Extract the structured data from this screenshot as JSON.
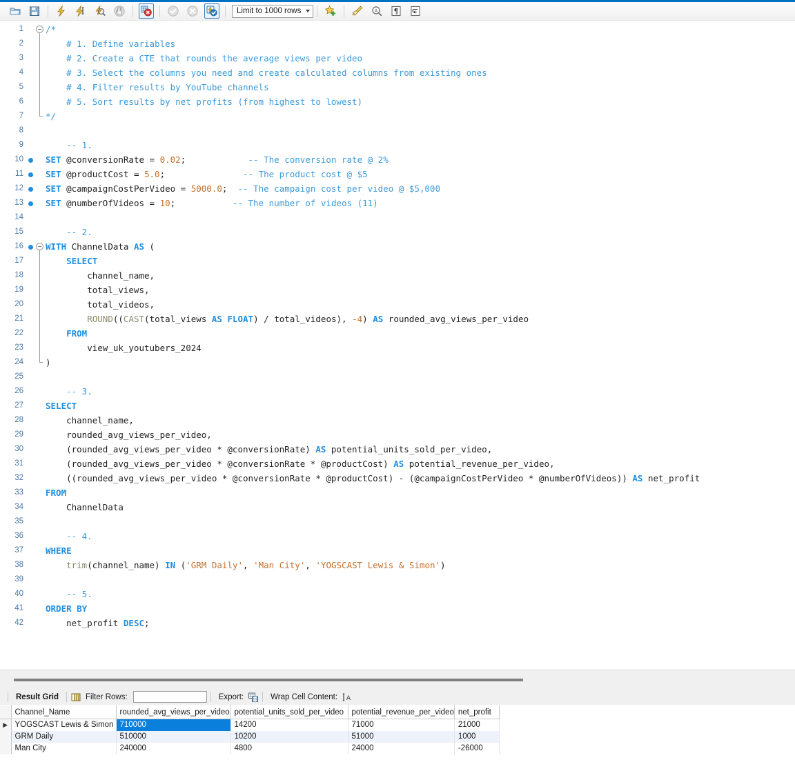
{
  "toolbar": {
    "items": [
      {
        "name": "open-sql-script-icon",
        "kind": "folder",
        "framed": false
      },
      {
        "name": "save-script-icon",
        "kind": "save",
        "framed": false
      },
      {
        "name": "separator",
        "kind": "sep"
      },
      {
        "name": "execute-statement-icon",
        "kind": "bolt",
        "framed": false
      },
      {
        "name": "execute-current-statement-icon",
        "kind": "bolt-cursor",
        "framed": false
      },
      {
        "name": "explain-statement-icon",
        "kind": "bolt-magnifier",
        "framed": false
      },
      {
        "name": "stop-execution-icon",
        "kind": "stop-hand",
        "framed": false
      },
      {
        "name": "separator",
        "kind": "sep"
      },
      {
        "name": "toggle-stop-on-error-icon",
        "kind": "stop-on-error",
        "framed": true
      },
      {
        "name": "separator",
        "kind": "sep"
      },
      {
        "name": "commit-transaction-icon",
        "kind": "commit",
        "framed": false
      },
      {
        "name": "rollback-transaction-icon",
        "kind": "rollback",
        "framed": false
      },
      {
        "name": "toggle-autocommit-icon",
        "kind": "autocommit",
        "framed": true
      },
      {
        "name": "separator",
        "kind": "sep"
      }
    ],
    "limit_combo": {
      "label": "Limit to 1000 rows",
      "name": "row-limit-dropdown"
    },
    "items_right": [
      {
        "name": "separator",
        "kind": "sep"
      },
      {
        "name": "save-snippet-icon",
        "kind": "star-plus",
        "framed": false
      },
      {
        "name": "separator",
        "kind": "sep"
      },
      {
        "name": "beautify-query-icon",
        "kind": "broom",
        "framed": false
      },
      {
        "name": "find-icon",
        "kind": "magnifier",
        "framed": false
      },
      {
        "name": "toggle-invisible-chars-icon",
        "kind": "pilcrow",
        "framed": false
      },
      {
        "name": "toggle-wrapping-icon",
        "kind": "wrap-arrow",
        "framed": false
      }
    ]
  },
  "editor": {
    "lines": [
      {
        "n": 1,
        "bp": false,
        "fold": "open",
        "tokens": [
          {
            "t": "/*",
            "c": "cmt"
          }
        ]
      },
      {
        "n": 2,
        "bp": false,
        "fold": "bar",
        "tokens": [
          {
            "t": "    # 1. Define variables",
            "c": "cmt"
          }
        ]
      },
      {
        "n": 3,
        "bp": false,
        "fold": "bar",
        "tokens": [
          {
            "t": "    # 2. Create a CTE that rounds the average views per video",
            "c": "cmt"
          }
        ]
      },
      {
        "n": 4,
        "bp": false,
        "fold": "bar",
        "tokens": [
          {
            "t": "    # 3. Select the columns you need and create calculated columns from existing ones",
            "c": "cmt"
          }
        ]
      },
      {
        "n": 5,
        "bp": false,
        "fold": "bar",
        "tokens": [
          {
            "t": "    # 4. Filter results by YouTube channels",
            "c": "cmt"
          }
        ]
      },
      {
        "n": 6,
        "bp": false,
        "fold": "bar",
        "tokens": [
          {
            "t": "    # 5. Sort results by net profits (from highest to lowest)",
            "c": "cmt"
          }
        ]
      },
      {
        "n": 7,
        "bp": false,
        "fold": "end",
        "tokens": [
          {
            "t": "*/",
            "c": "cmt"
          }
        ]
      },
      {
        "n": 8,
        "bp": false,
        "fold": "",
        "tokens": []
      },
      {
        "n": 9,
        "bp": false,
        "fold": "",
        "tokens": [
          {
            "t": "    -- 1.",
            "c": "cmt"
          }
        ]
      },
      {
        "n": 10,
        "bp": true,
        "fold": "",
        "tokens": [
          {
            "t": "SET ",
            "c": "kw"
          },
          {
            "t": "@conversionRate = ",
            "c": "pln"
          },
          {
            "t": "0.02",
            "c": "numl"
          },
          {
            "t": ";            ",
            "c": "pln"
          },
          {
            "t": "-- The conversion rate @ 2%",
            "c": "cmt"
          }
        ]
      },
      {
        "n": 11,
        "bp": true,
        "fold": "",
        "tokens": [
          {
            "t": "SET ",
            "c": "kw"
          },
          {
            "t": "@productCost = ",
            "c": "pln"
          },
          {
            "t": "5.0",
            "c": "numl"
          },
          {
            "t": ";               ",
            "c": "pln"
          },
          {
            "t": "-- The product cost @ $5",
            "c": "cmt"
          }
        ]
      },
      {
        "n": 12,
        "bp": true,
        "fold": "",
        "tokens": [
          {
            "t": "SET ",
            "c": "kw"
          },
          {
            "t": "@campaignCostPerVideo = ",
            "c": "pln"
          },
          {
            "t": "5000.0",
            "c": "numl"
          },
          {
            "t": ";  ",
            "c": "pln"
          },
          {
            "t": "-- The campaign cost per video @ $5,000",
            "c": "cmt"
          }
        ]
      },
      {
        "n": 13,
        "bp": true,
        "fold": "",
        "tokens": [
          {
            "t": "SET ",
            "c": "kw"
          },
          {
            "t": "@numberOfVideos = ",
            "c": "pln"
          },
          {
            "t": "10",
            "c": "numl"
          },
          {
            "t": ";           ",
            "c": "pln"
          },
          {
            "t": "-- The number of videos (11)",
            "c": "cmt"
          }
        ]
      },
      {
        "n": 14,
        "bp": false,
        "fold": "",
        "tokens": []
      },
      {
        "n": 15,
        "bp": false,
        "fold": "",
        "tokens": [
          {
            "t": "    -- 2.",
            "c": "cmt"
          }
        ]
      },
      {
        "n": 16,
        "bp": true,
        "fold": "open",
        "tokens": [
          {
            "t": "WITH ",
            "c": "kw"
          },
          {
            "t": "ChannelData ",
            "c": "pln"
          },
          {
            "t": "AS",
            "c": "kw"
          },
          {
            "t": " (",
            "c": "pln"
          }
        ]
      },
      {
        "n": 17,
        "bp": false,
        "fold": "bar",
        "tokens": [
          {
            "t": "    SELECT",
            "c": "kw"
          }
        ]
      },
      {
        "n": 18,
        "bp": false,
        "fold": "bar",
        "tokens": [
          {
            "t": "        channel_name,",
            "c": "pln"
          }
        ]
      },
      {
        "n": 19,
        "bp": false,
        "fold": "bar",
        "tokens": [
          {
            "t": "        total_views,",
            "c": "pln"
          }
        ]
      },
      {
        "n": 20,
        "bp": false,
        "fold": "bar",
        "tokens": [
          {
            "t": "        total_videos,",
            "c": "pln"
          }
        ]
      },
      {
        "n": 21,
        "bp": false,
        "fold": "bar",
        "tokens": [
          {
            "t": "        ",
            "c": "pln"
          },
          {
            "t": "ROUND",
            "c": "fn"
          },
          {
            "t": "((",
            "c": "pln"
          },
          {
            "t": "CAST",
            "c": "fn"
          },
          {
            "t": "(total_views ",
            "c": "pln"
          },
          {
            "t": "AS FLOAT",
            "c": "kw"
          },
          {
            "t": ") / total_videos), ",
            "c": "pln"
          },
          {
            "t": "-4",
            "c": "numl"
          },
          {
            "t": ") ",
            "c": "pln"
          },
          {
            "t": "AS",
            "c": "kw"
          },
          {
            "t": " rounded_avg_views_per_video",
            "c": "pln"
          }
        ]
      },
      {
        "n": 22,
        "bp": false,
        "fold": "bar",
        "tokens": [
          {
            "t": "    FROM",
            "c": "kw"
          }
        ]
      },
      {
        "n": 23,
        "bp": false,
        "fold": "bar",
        "tokens": [
          {
            "t": "        view_uk_youtubers_2024",
            "c": "pln"
          }
        ]
      },
      {
        "n": 24,
        "bp": false,
        "fold": "end",
        "tokens": [
          {
            "t": ")",
            "c": "pln"
          }
        ]
      },
      {
        "n": 25,
        "bp": false,
        "fold": "",
        "tokens": []
      },
      {
        "n": 26,
        "bp": false,
        "fold": "",
        "tokens": [
          {
            "t": "    -- 3.",
            "c": "cmt"
          }
        ]
      },
      {
        "n": 27,
        "bp": false,
        "fold": "",
        "tokens": [
          {
            "t": "SELECT",
            "c": "kw"
          }
        ]
      },
      {
        "n": 28,
        "bp": false,
        "fold": "",
        "tokens": [
          {
            "t": "    channel_name,",
            "c": "pln"
          }
        ]
      },
      {
        "n": 29,
        "bp": false,
        "fold": "",
        "tokens": [
          {
            "t": "    rounded_avg_views_per_video,",
            "c": "pln"
          }
        ]
      },
      {
        "n": 30,
        "bp": false,
        "fold": "",
        "tokens": [
          {
            "t": "    (rounded_avg_views_per_video * @conversionRate) ",
            "c": "pln"
          },
          {
            "t": "AS",
            "c": "kw"
          },
          {
            "t": " potential_units_sold_per_video,",
            "c": "pln"
          }
        ]
      },
      {
        "n": 31,
        "bp": false,
        "fold": "",
        "tokens": [
          {
            "t": "    (rounded_avg_views_per_video * @conversionRate * @productCost) ",
            "c": "pln"
          },
          {
            "t": "AS",
            "c": "kw"
          },
          {
            "t": " potential_revenue_per_video,",
            "c": "pln"
          }
        ]
      },
      {
        "n": 32,
        "bp": false,
        "fold": "",
        "tokens": [
          {
            "t": "    ((rounded_avg_views_per_video * @conversionRate * @productCost) - (@campaignCostPerVideo * @numberOfVideos)) ",
            "c": "pln"
          },
          {
            "t": "AS",
            "c": "kw"
          },
          {
            "t": " net_profit",
            "c": "pln"
          }
        ]
      },
      {
        "n": 33,
        "bp": false,
        "fold": "",
        "tokens": [
          {
            "t": "FROM",
            "c": "kw"
          }
        ]
      },
      {
        "n": 34,
        "bp": false,
        "fold": "",
        "tokens": [
          {
            "t": "    ChannelData",
            "c": "pln"
          }
        ]
      },
      {
        "n": 35,
        "bp": false,
        "fold": "",
        "tokens": []
      },
      {
        "n": 36,
        "bp": false,
        "fold": "",
        "tokens": [
          {
            "t": "    -- 4.",
            "c": "cmt"
          }
        ]
      },
      {
        "n": 37,
        "bp": false,
        "fold": "",
        "tokens": [
          {
            "t": "WHERE",
            "c": "kw"
          }
        ]
      },
      {
        "n": 38,
        "bp": false,
        "fold": "",
        "tokens": [
          {
            "t": "    ",
            "c": "pln"
          },
          {
            "t": "trim",
            "c": "fn"
          },
          {
            "t": "(channel_name) ",
            "c": "pln"
          },
          {
            "t": "IN",
            "c": "kw"
          },
          {
            "t": " (",
            "c": "pln"
          },
          {
            "t": "'GRM Daily'",
            "c": "str"
          },
          {
            "t": ", ",
            "c": "pln"
          },
          {
            "t": "'Man City'",
            "c": "str"
          },
          {
            "t": ", ",
            "c": "pln"
          },
          {
            "t": "'YOGSCAST Lewis & Simon'",
            "c": "str"
          },
          {
            "t": ")",
            "c": "pln"
          }
        ]
      },
      {
        "n": 39,
        "bp": false,
        "fold": "",
        "tokens": []
      },
      {
        "n": 40,
        "bp": false,
        "fold": "",
        "tokens": [
          {
            "t": "    -- 5.",
            "c": "cmt"
          }
        ]
      },
      {
        "n": 41,
        "bp": false,
        "fold": "",
        "tokens": [
          {
            "t": "ORDER BY",
            "c": "kw"
          }
        ]
      },
      {
        "n": 42,
        "bp": false,
        "fold": "",
        "tokens": [
          {
            "t": "    net_profit ",
            "c": "pln"
          },
          {
            "t": "DESC",
            "c": "kw"
          },
          {
            "t": ";",
            "c": "pln"
          }
        ]
      }
    ]
  },
  "result_panel": {
    "tab_label": "Result Grid",
    "grid_view_icon": "grid-view-icon",
    "filter_label": "Filter Rows:",
    "filter_value": "",
    "filter_placeholder": "",
    "export_label": "Export:",
    "export_icon": "export-icon",
    "wrap_label": "Wrap Cell Content:",
    "wrap_icon": "wrap-cell-icon"
  },
  "result_grid": {
    "columns": [
      "Channel_Name",
      "rounded_avg_views_per_video",
      "potential_units_sold_per_video",
      "potential_revenue_per_video",
      "net_profit"
    ],
    "rows": [
      {
        "marker": "▶",
        "alt": false,
        "cells": [
          "YOGSCAST Lewis & Simon",
          "710000",
          "14200",
          "71000",
          "21000"
        ],
        "selected_col": 1
      },
      {
        "marker": "",
        "alt": true,
        "cells": [
          "GRM Daily",
          "510000",
          "10200",
          "51000",
          "1000"
        ],
        "selected_col": -1
      },
      {
        "marker": "",
        "alt": false,
        "cells": [
          "Man City",
          "240000",
          "4800",
          "24000",
          "-26000"
        ],
        "selected_col": -1
      }
    ]
  },
  "colors": {
    "accent": "#0072c6",
    "keyword": "#1f8ee0",
    "comment": "#3c9ad9",
    "string": "#c07030",
    "number": "#c07030",
    "function": "#8a8a6a",
    "selection": "#0a7fdc"
  }
}
